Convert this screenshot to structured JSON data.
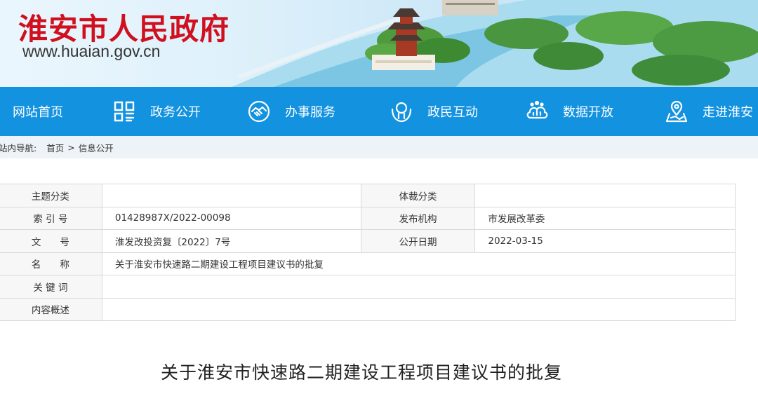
{
  "header": {
    "title": "淮安市人民政府",
    "url": "www.huaian.gov.cn",
    "brand_color": "#d0101e"
  },
  "nav": {
    "bg_color": "#1392e0",
    "items": [
      {
        "label": "网站首页",
        "icon": "none"
      },
      {
        "label": "政务公开",
        "icon": "grid-icon"
      },
      {
        "label": "办事服务",
        "icon": "handshake-icon"
      },
      {
        "label": "政民互动",
        "icon": "hands-icon"
      },
      {
        "label": "数据开放",
        "icon": "data-cloud-icon"
      },
      {
        "label": "走进淮安",
        "icon": "map-pin-icon"
      }
    ]
  },
  "breadcrumb": {
    "label": "站内导航:",
    "items": [
      "首页",
      "信息公开"
    ],
    "separator": ">"
  },
  "info_table": {
    "rows": [
      {
        "k1": "主题分类",
        "v1": "",
        "k2": "体裁分类",
        "v2": ""
      },
      {
        "k1": "索 引 号",
        "v1": "01428987X/2022-00098",
        "k2": "发布机构",
        "v2": "市发展改革委"
      },
      {
        "k1": "文　　号",
        "v1": "淮发改投资复〔2022〕7号",
        "k2": "公开日期",
        "v2": "2022-03-15"
      },
      {
        "k1": "名　　称",
        "v1": "关于淮安市快速路二期建设工程项目建议书的批复"
      },
      {
        "k1": "关 键 词",
        "v1": ""
      },
      {
        "k1": "内容概述",
        "v1": ""
      }
    ]
  },
  "document": {
    "title": "关于淮安市快速路二期建设工程项目建议书的批复"
  }
}
